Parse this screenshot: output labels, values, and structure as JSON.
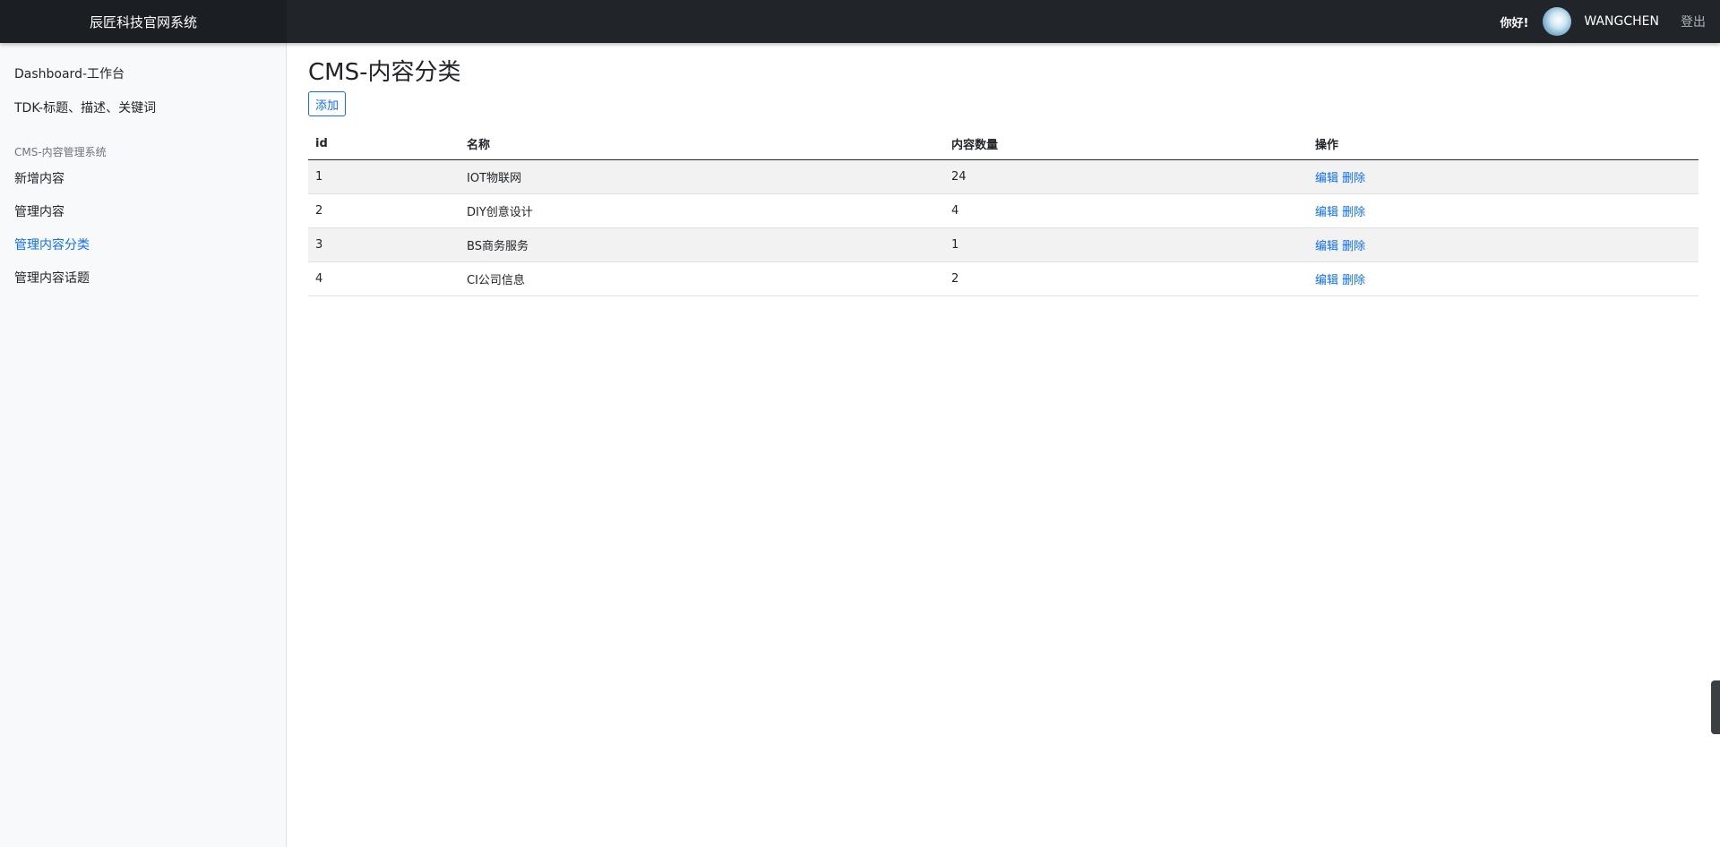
{
  "header": {
    "brand": "辰匠科技官网系统",
    "greeting": "你好!",
    "username": "WANGCHEN",
    "logout": "登出"
  },
  "sidebar": {
    "items": [
      {
        "label": "Dashboard-工作台"
      },
      {
        "label": "TDK-标题、描述、关键词"
      }
    ],
    "section_heading": "CMS-内容管理系统",
    "section_items": [
      {
        "label": "新增内容"
      },
      {
        "label": "管理内容"
      },
      {
        "label": "管理内容分类",
        "active": true
      },
      {
        "label": "管理内容话题"
      }
    ]
  },
  "main": {
    "title": "CMS-内容分类",
    "add_button": "添加",
    "table": {
      "columns": [
        "id",
        "名称",
        "内容数量",
        "操作"
      ],
      "rows": [
        {
          "id": "1",
          "name": "IOT物联网",
          "count": "24",
          "edit": "编辑",
          "delete": "删除"
        },
        {
          "id": "2",
          "name": "DIY创意设计",
          "count": "4",
          "edit": "编辑",
          "delete": "删除"
        },
        {
          "id": "3",
          "name": "BS商务服务",
          "count": "1",
          "edit": "编辑",
          "delete": "删除"
        },
        {
          "id": "4",
          "name": "CI公司信息",
          "count": "2",
          "edit": "编辑",
          "delete": "删除"
        }
      ]
    }
  },
  "colors": {
    "accent": "#0d6efd",
    "header_bg": "#212529",
    "sidebar_bg": "#f8f9fa"
  }
}
